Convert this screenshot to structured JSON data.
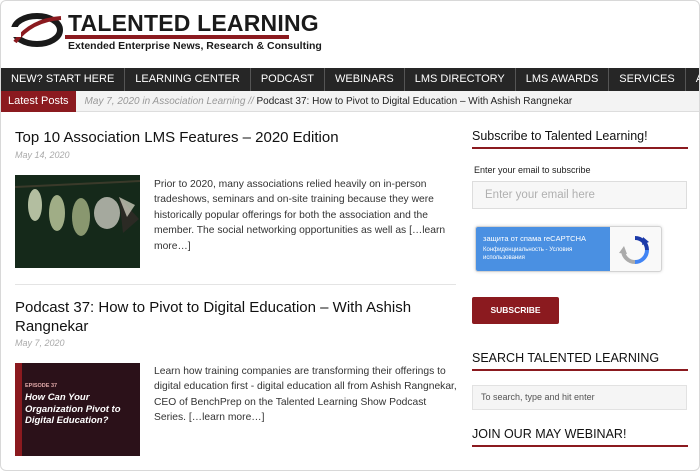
{
  "brand": {
    "title": "TALENTED LEARNING",
    "tagline": "Extended Enterprise News, Research & Consulting"
  },
  "nav": {
    "items": [
      {
        "label": "NEW? START HERE"
      },
      {
        "label": "LEARNING CENTER"
      },
      {
        "label": "PODCAST"
      },
      {
        "label": "WEBINARS"
      },
      {
        "label": "LMS DIRECTORY"
      },
      {
        "label": "LMS AWARDS"
      },
      {
        "label": "SERVICES"
      },
      {
        "label": "ABOUT"
      }
    ]
  },
  "ticker": {
    "label": "Latest Posts",
    "meta": "May 7, 2020 in Association Learning // ",
    "link": "Podcast 37: How to Pivot to Digital Education – With Ashish Rangnekar"
  },
  "posts": [
    {
      "title": "Top 10 Association LMS Features – 2020 Edition",
      "date": "May 14, 2020",
      "excerpt": "Prior to 2020, many associations relied heavily on in-person tradeshows, seminars and on-site training because they were historically popular offerings for both the association and the member.  The social networking opportunities as well as ",
      "read_more": "[…learn more…]"
    },
    {
      "title": "Podcast 37: How to Pivot to Digital Education – With Ashish Rangnekar",
      "date": "May 7, 2020",
      "excerpt": "Learn how training companies are transforming their offerings to digital education first - digital education all from Ashish Rangnekar, CEO of BenchPrep on the Talented Learning Show Podcast Series. ",
      "read_more": "[…learn more…]",
      "thumb_episode": "EPISODE 37",
      "thumb_headline": "How Can Your Organization Pivot to Digital Education?"
    }
  ],
  "sidebar": {
    "subscribe_heading": "Subscribe to Talented Learning!",
    "email_label": "Enter your email to subscribe",
    "email_placeholder": "Enter your email here",
    "captcha_title": "защита от спама reCAPTCHA",
    "captcha_sub": "Конфиденциальность - Условия использования",
    "subscribe_button": "SUBSCRIBE",
    "search_heading": "SEARCH TALENTED LEARNING",
    "search_placeholder": "To search, type and hit enter",
    "webinar_heading": "JOIN OUR MAY WEBINAR!"
  },
  "colors": {
    "brand_red": "#8b1a1f",
    "nav_bg": "#262626",
    "captcha_blue": "#4a90e2"
  }
}
